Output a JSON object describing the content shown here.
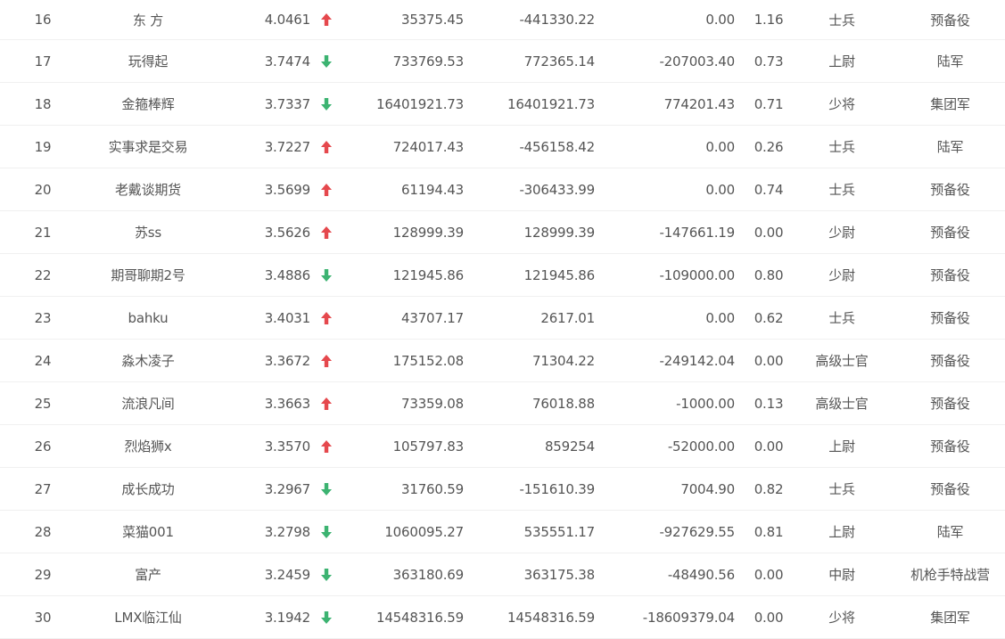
{
  "colors": {
    "up": "#e5484d",
    "down": "#3cb371"
  },
  "rows": [
    {
      "rank": "16",
      "name": "东 方",
      "score": "4.0461",
      "trend": "up",
      "trend_icon": "arrow-up-icon",
      "v1": "35375.45",
      "v2": "-441330.22",
      "v3": "0.00",
      "ratio": "1.16",
      "military_rank": "士兵",
      "level": "预备役"
    },
    {
      "rank": "17",
      "name": "玩得起",
      "score": "3.7474",
      "trend": "down",
      "trend_icon": "arrow-down-icon",
      "v1": "733769.53",
      "v2": "772365.14",
      "v3": "-207003.40",
      "ratio": "0.73",
      "military_rank": "上尉",
      "level": "陆军"
    },
    {
      "rank": "18",
      "name": "金箍棒辉",
      "score": "3.7337",
      "trend": "down",
      "trend_icon": "arrow-down-icon",
      "v1": "16401921.73",
      "v2": "16401921.73",
      "v3": "774201.43",
      "ratio": "0.71",
      "military_rank": "少将",
      "level": "集团军"
    },
    {
      "rank": "19",
      "name": "实事求是交易",
      "score": "3.7227",
      "trend": "up",
      "trend_icon": "arrow-up-icon",
      "v1": "724017.43",
      "v2": "-456158.42",
      "v3": "0.00",
      "ratio": "0.26",
      "military_rank": "士兵",
      "level": "陆军"
    },
    {
      "rank": "20",
      "name": "老戴谈期货",
      "score": "3.5699",
      "trend": "up",
      "trend_icon": "arrow-up-icon",
      "v1": "61194.43",
      "v2": "-306433.99",
      "v3": "0.00",
      "ratio": "0.74",
      "military_rank": "士兵",
      "level": "预备役"
    },
    {
      "rank": "21",
      "name": "苏ss",
      "score": "3.5626",
      "trend": "up",
      "trend_icon": "arrow-up-icon",
      "v1": "128999.39",
      "v2": "128999.39",
      "v3": "-147661.19",
      "ratio": "0.00",
      "military_rank": "少尉",
      "level": "预备役"
    },
    {
      "rank": "22",
      "name": "期哥聊期2号",
      "score": "3.4886",
      "trend": "down",
      "trend_icon": "arrow-down-icon",
      "v1": "121945.86",
      "v2": "121945.86",
      "v3": "-109000.00",
      "ratio": "0.80",
      "military_rank": "少尉",
      "level": "预备役"
    },
    {
      "rank": "23",
      "name": "bahku",
      "score": "3.4031",
      "trend": "up",
      "trend_icon": "arrow-up-icon",
      "v1": "43707.17",
      "v2": "2617.01",
      "v3": "0.00",
      "ratio": "0.62",
      "military_rank": "士兵",
      "level": "预备役"
    },
    {
      "rank": "24",
      "name": "淼木凌子",
      "score": "3.3672",
      "trend": "up",
      "trend_icon": "arrow-up-icon",
      "v1": "175152.08",
      "v2": "71304.22",
      "v3": "-249142.04",
      "ratio": "0.00",
      "military_rank": "高级士官",
      "level": "预备役"
    },
    {
      "rank": "25",
      "name": "流浪凡间",
      "score": "3.3663",
      "trend": "up",
      "trend_icon": "arrow-up-icon",
      "v1": "73359.08",
      "v2": "76018.88",
      "v3": "-1000.00",
      "ratio": "0.13",
      "military_rank": "高级士官",
      "level": "预备役"
    },
    {
      "rank": "26",
      "name": "烈焰狮x",
      "score": "3.3570",
      "trend": "up",
      "trend_icon": "arrow-up-icon",
      "v1": "105797.83",
      "v2": "859254",
      "v3": "-52000.00",
      "ratio": "0.00",
      "military_rank": "上尉",
      "level": "预备役"
    },
    {
      "rank": "27",
      "name": "成长成功",
      "score": "3.2967",
      "trend": "down",
      "trend_icon": "arrow-down-icon",
      "v1": "31760.59",
      "v2": "-151610.39",
      "v3": "7004.90",
      "ratio": "0.82",
      "military_rank": "士兵",
      "level": "预备役"
    },
    {
      "rank": "28",
      "name": "菜猫001",
      "score": "3.2798",
      "trend": "down",
      "trend_icon": "arrow-down-icon",
      "v1": "1060095.27",
      "v2": "535551.17",
      "v3": "-927629.55",
      "ratio": "0.81",
      "military_rank": "上尉",
      "level": "陆军"
    },
    {
      "rank": "29",
      "name": "富产",
      "score": "3.2459",
      "trend": "down",
      "trend_icon": "arrow-down-icon",
      "v1": "363180.69",
      "v2": "363175.38",
      "v3": "-48490.56",
      "ratio": "0.00",
      "military_rank": "中尉",
      "level": "机枪手特战营"
    },
    {
      "rank": "30",
      "name": "LMX临江仙",
      "score": "3.1942",
      "trend": "down",
      "trend_icon": "arrow-down-icon",
      "v1": "14548316.59",
      "v2": "14548316.59",
      "v3": "-18609379.04",
      "ratio": "0.00",
      "military_rank": "少将",
      "level": "集团军"
    }
  ]
}
